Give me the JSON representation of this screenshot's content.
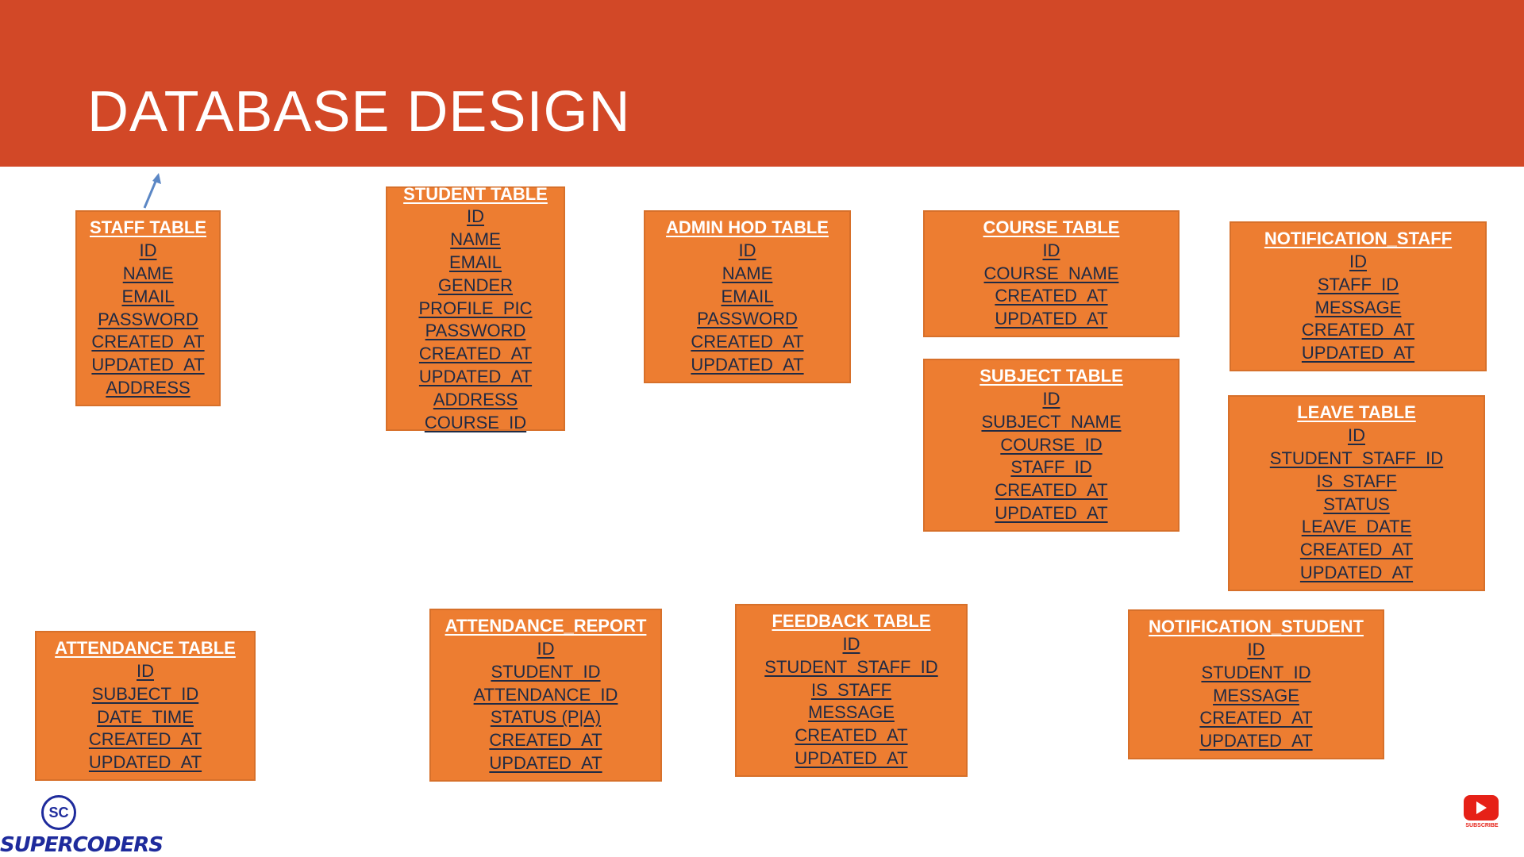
{
  "slide": {
    "title": "DATABASE DESIGN",
    "header_color": "#d24827",
    "box_color": "#ed7d31"
  },
  "tables": {
    "staff": {
      "title": "STAFF TABLE",
      "fields": [
        "ID",
        "NAME",
        "EMAIL",
        "PASSWORD",
        "CREATED_AT",
        "UPDATED_AT",
        "ADDRESS"
      ]
    },
    "student": {
      "title": "STUDENT TABLE",
      "fields": [
        "ID",
        "NAME",
        "EMAIL",
        "GENDER",
        "PROFILE_PIC",
        "PASSWORD",
        "CREATED_AT",
        "UPDATED_AT",
        "ADDRESS",
        "COURSE_ID"
      ]
    },
    "admin_hod": {
      "title": "ADMIN HOD TABLE",
      "fields": [
        "ID",
        "NAME",
        "EMAIL",
        "PASSWORD",
        "CREATED_AT",
        "UPDATED_AT"
      ]
    },
    "course": {
      "title": "COURSE TABLE",
      "fields": [
        "ID",
        "COURSE_NAME",
        "CREATED_AT",
        "UPDATED_AT"
      ]
    },
    "notification_staff": {
      "title": "NOTIFICATION_STAFF",
      "fields": [
        "ID",
        "STAFF_ID",
        "MESSAGE",
        "CREATED_AT",
        "UPDATED_AT"
      ]
    },
    "subject": {
      "title": "SUBJECT TABLE",
      "fields": [
        "ID",
        "SUBJECT_NAME",
        "COURSE_ID",
        "STAFF_ID",
        "CREATED_AT",
        "UPDATED_AT"
      ]
    },
    "leave": {
      "title": "LEAVE TABLE",
      "fields": [
        "ID",
        "STUDENT_STAFF_ID",
        "IS_STAFF",
        "STATUS",
        "LEAVE_DATE",
        "CREATED_AT",
        "UPDATED_AT"
      ]
    },
    "attendance": {
      "title": "ATTENDANCE TABLE",
      "fields": [
        "ID",
        "SUBJECT_ID",
        "DATE_TIME",
        "CREATED_AT",
        "UPDATED_AT"
      ]
    },
    "attendance_report": {
      "title": "ATTENDANCE_REPORT",
      "fields": [
        "ID",
        "STUDENT_ID",
        "ATTENDANCE_ID",
        "STATUS (P|A)",
        "CREATED_AT",
        "UPDATED_AT"
      ]
    },
    "feedback": {
      "title": "FEEDBACK TABLE",
      "fields": [
        "ID",
        "STUDENT_STAFF_ID",
        "IS_STAFF",
        "MESSAGE",
        "CREATED_AT",
        "UPDATED_AT"
      ]
    },
    "notification_student": {
      "title": "NOTIFICATION_STUDENT",
      "fields": [
        "ID",
        "STUDENT_ID",
        "MESSAGE",
        "CREATED_AT",
        "UPDATED_AT"
      ]
    }
  },
  "logo": {
    "initials": "SC",
    "brand": "SUPERCODERS"
  },
  "subscribe": {
    "label": "SUBSCRIBE"
  }
}
